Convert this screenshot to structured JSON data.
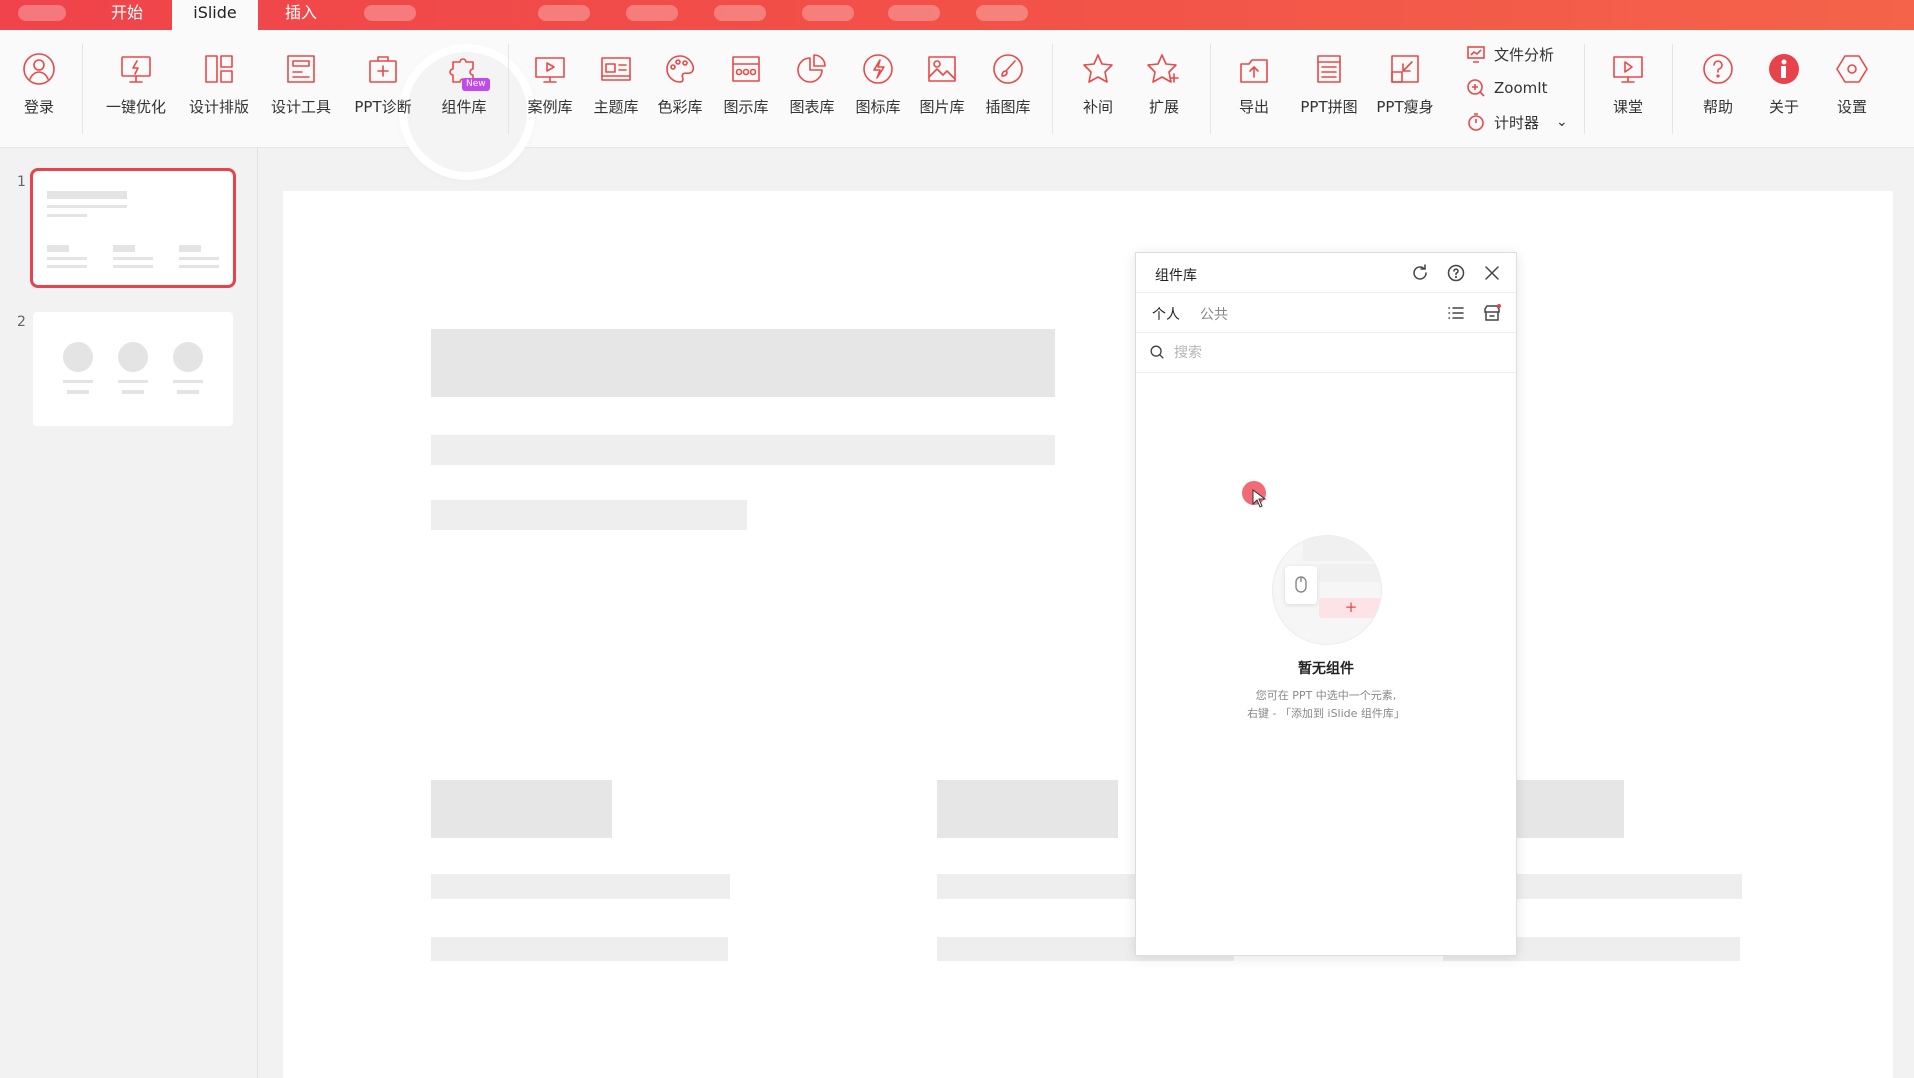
{
  "tabs": {
    "start": "开始",
    "islide": "iSlide",
    "insert": "插入"
  },
  "ribbon": {
    "login": "登录",
    "optimize": "一键优化",
    "layout": "设计排版",
    "tools": "设计工具",
    "diagnose": "PPT诊断",
    "components": "组件库",
    "new_badge": "New",
    "cases": "案例库",
    "themes": "主题库",
    "colors": "色彩库",
    "diagrams": "图示库",
    "charts": "图表库",
    "icons": "图标库",
    "images": "图片库",
    "illustrations": "插图库",
    "tween": "补间",
    "extend": "扩展",
    "export": "导出",
    "collage": "PPT拼图",
    "slim": "PPT瘦身",
    "file_analysis": "文件分析",
    "zoomit": "ZoomIt",
    "timer": "计时器",
    "classroom": "课堂",
    "help": "帮助",
    "about": "关于",
    "settings": "设置"
  },
  "thumbnails": [
    {
      "num": "1"
    },
    {
      "num": "2"
    }
  ],
  "panel": {
    "title": "组件库",
    "tab_personal": "个人",
    "tab_public": "公共",
    "search_placeholder": "搜索",
    "empty_title": "暂无组件",
    "empty_desc_1": "您可在 PPT 中选中一个元素,",
    "empty_desc_2": "右键 - 「添加到 iSlide 组件库」"
  },
  "colors": {
    "accent": "#e8434c",
    "tab_gradient_start": "#f0434b",
    "tab_gradient_end": "#f4634a",
    "icon_stroke": "#e84a4a",
    "new_badge": "#c04be8"
  }
}
